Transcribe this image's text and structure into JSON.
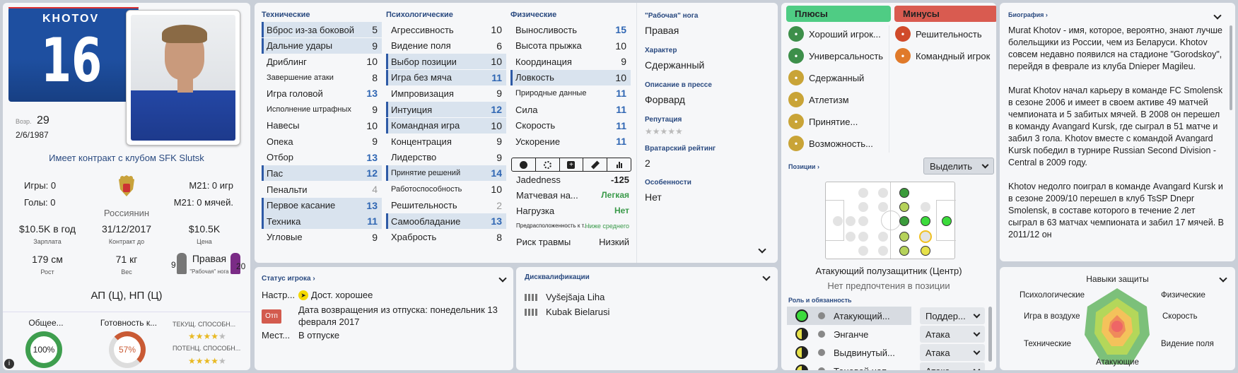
{
  "player": {
    "name": "KHOTOV",
    "number": "16",
    "age_label": "Возр.",
    "age": "29",
    "birthdate": "2/6/1987",
    "contract_club": "Имеет контракт с клубом SFK Slutsk",
    "games": "Игры: 0",
    "goals": "Голы: 0",
    "u21_games": "М21: 0 игр",
    "u21_goals": "М21: 0 мячей.",
    "nationality": "Россиянин",
    "wage": "$10.5K в год",
    "wage_label": "Зарплата",
    "contract_end": "31/12/2017",
    "contract_end_label": "Контракт до",
    "value": "$10.5K",
    "value_label": "Цена",
    "height": "179 см",
    "height_label": "Рост",
    "weight": "71 кг",
    "weight_label": "Вес",
    "foot": "Правая",
    "foot_label": "\"Рабочая\" нога",
    "left_foot_rating": "9",
    "right_foot_rating": "20",
    "positions": "АП (Ц), НП (Ц)",
    "overall_label": "Общее...",
    "overall": "100%",
    "readiness_label": "Готовность к...",
    "readiness": "57%",
    "current_ability_label": "ТЕКУЩ. СПОСОБН...",
    "potential_ability_label": "ПОТЕНЦ. СПОСОБН...",
    "current_ability_stars": 4,
    "potential_ability_stars": 4
  },
  "attributes": {
    "technical_title": "Технические",
    "mental_title": "Психологические",
    "physical_title": "Физические",
    "technical": [
      {
        "label": "Вброс из-за боковой",
        "value": "5",
        "hl": true,
        "style": ""
      },
      {
        "label": "Дальние удары",
        "value": "9",
        "hl": true,
        "style": ""
      },
      {
        "label": "Дриблинг",
        "value": "10",
        "hl": false,
        "style": ""
      },
      {
        "label": "Завершение атаки",
        "value": "8",
        "hl": false,
        "style": "",
        "small": true
      },
      {
        "label": "Игра головой",
        "value": "13",
        "hl": false,
        "style": "blue"
      },
      {
        "label": "Исполнение штрафных",
        "value": "9",
        "hl": false,
        "style": "",
        "small": true
      },
      {
        "label": "Навесы",
        "value": "10",
        "hl": false,
        "style": ""
      },
      {
        "label": "Опека",
        "value": "9",
        "hl": false,
        "style": ""
      },
      {
        "label": "Отбор",
        "value": "13",
        "hl": false,
        "style": "blue"
      },
      {
        "label": "Пас",
        "value": "12",
        "hl": true,
        "style": "blue"
      },
      {
        "label": "Пенальти",
        "value": "4",
        "hl": false,
        "style": "grey"
      },
      {
        "label": "Первое касание",
        "value": "13",
        "hl": true,
        "style": "blue"
      },
      {
        "label": "Техника",
        "value": "11",
        "hl": true,
        "style": "blue"
      },
      {
        "label": "Угловые",
        "value": "9",
        "hl": false,
        "style": ""
      }
    ],
    "mental": [
      {
        "label": "Агрессивность",
        "value": "10",
        "hl": false,
        "style": ""
      },
      {
        "label": "Видение поля",
        "value": "6",
        "hl": false,
        "style": ""
      },
      {
        "label": "Выбор позиции",
        "value": "10",
        "hl": true,
        "style": ""
      },
      {
        "label": "Игра без мяча",
        "value": "11",
        "hl": true,
        "style": "blue"
      },
      {
        "label": "Импровизация",
        "value": "9",
        "hl": false,
        "style": ""
      },
      {
        "label": "Интуиция",
        "value": "12",
        "hl": true,
        "style": "blue"
      },
      {
        "label": "Командная игра",
        "value": "10",
        "hl": true,
        "style": ""
      },
      {
        "label": "Концентрация",
        "value": "9",
        "hl": false,
        "style": ""
      },
      {
        "label": "Лидерство",
        "value": "9",
        "hl": false,
        "style": ""
      },
      {
        "label": "Принятие решений",
        "value": "14",
        "hl": true,
        "style": "blue",
        "small": true
      },
      {
        "label": "Работоспособность",
        "value": "10",
        "hl": false,
        "style": "",
        "small": true
      },
      {
        "label": "Решительность",
        "value": "2",
        "hl": false,
        "style": "grey"
      },
      {
        "label": "Самообладание",
        "value": "13",
        "hl": true,
        "style": "blue"
      },
      {
        "label": "Храбрость",
        "value": "8",
        "hl": false,
        "style": ""
      }
    ],
    "physical": [
      {
        "label": "Выносливость",
        "value": "15",
        "hl": false,
        "style": "blue"
      },
      {
        "label": "Высота прыжка",
        "value": "10",
        "hl": false,
        "style": ""
      },
      {
        "label": "Координация",
        "value": "9",
        "hl": false,
        "style": ""
      },
      {
        "label": "Ловкость",
        "value": "10",
        "hl": true,
        "style": ""
      },
      {
        "label": "Природные данные",
        "value": "11",
        "hl": false,
        "style": "blue",
        "small": true
      },
      {
        "label": "Сила",
        "value": "11",
        "hl": false,
        "style": "blue"
      },
      {
        "label": "Скорость",
        "value": "11",
        "hl": false,
        "style": "blue"
      },
      {
        "label": "Ускорение",
        "value": "11",
        "hl": false,
        "style": "blue"
      }
    ]
  },
  "condition": {
    "jadedness_label": "Jadedness",
    "jadedness": "-125",
    "match_load_label": "Матчевая на...",
    "match_load": "Легкая",
    "load_label": "Нагрузка",
    "load": "Нет",
    "injury_prone_label": "Предрасположенность к т...",
    "injury_prone": "Ниже среднего",
    "injury_risk_label": "Риск травмы",
    "injury_risk": "Низкий"
  },
  "side": {
    "foot_label": "\"Рабочая\" нога",
    "foot": "Правая",
    "character_label": "Характер",
    "character": "Сдержанный",
    "press_label": "Описание в прессе",
    "press": "Форвард",
    "reputation_label": "Репутация",
    "reputation_stars": 0,
    "gk_rating_label": "Вратарский рейтинг",
    "gk_rating": "2",
    "features_label": "Особенности",
    "features": "Нет"
  },
  "traits": {
    "pros_label": "Плюсы",
    "cons_label": "Минусы",
    "pros": [
      {
        "label": "Хороший игрок...",
        "icon": "star-icon",
        "color": "#3d8f4a"
      },
      {
        "label": "Универсальность",
        "icon": "leaf-icon",
        "color": "#3d8f4a"
      },
      {
        "label": "Сдержанный",
        "icon": "balloon-icon",
        "color": "#c9a437"
      },
      {
        "label": "Атлетизм",
        "icon": "pen-icon",
        "color": "#c9a437"
      },
      {
        "label": "Принятие...",
        "icon": "hand-icon",
        "color": "#c9a437"
      },
      {
        "label": "Возможность...",
        "icon": "ball-icon",
        "color": "#c9a437"
      }
    ],
    "cons": [
      {
        "label": "Решительность",
        "icon": "magnifier-icon",
        "color": "#d04a2a"
      },
      {
        "label": "Командный игрок",
        "icon": "people-icon",
        "color": "#e07a2a"
      }
    ]
  },
  "positions": {
    "title": "Позиции",
    "highlight_btn": "Выделить",
    "main_position": "Атакующий полузащитник (Центр)",
    "preference": "Нет предпочтения в позиции"
  },
  "roles": {
    "title": "Роль и обязанность",
    "items": [
      {
        "role": "Атакующий...",
        "duty": "Поддер...",
        "fill": "full"
      },
      {
        "role": "Энганче",
        "duty": "Атака",
        "fill": "half"
      },
      {
        "role": "Выдвинутый...",
        "duty": "Атака",
        "fill": "half"
      },
      {
        "role": "Теневой нап...",
        "duty": "Атака",
        "fill": "half"
      }
    ]
  },
  "bio": {
    "title": "Биография",
    "p1": "Murat Khotov - имя, которое, вероятно, знают лучше болельщики из России, чем из Беларуси. Khotov совсем недавно появился на стадионе \"Gorodskoy\", перейдя в феврале из клуба Dnieper Magileu.",
    "p2": "Murat Khotov начал карьеру в команде FC Smolensk в сезоне 2006 и имеет в своем активе 49 матчей чемпионата и 5 забитых мячей. В 2008 он перешел в команду Avangard Kursk, где сыграл в 51 матче и забил 3 гола. Khotov вместе с командой Avangard Kursk победил в турнире Russian Second Division - Central в 2009 году.",
    "p3": "Khotov недолго поиграл в команде Avangard Kursk и в сезоне 2009/10 перешел в клуб TsSP Dnepr Smolensk, в составе которого в течение 2 лет сыграл в 63 матчах чемпионата и забил 17 мячей. В 2011/12 он"
  },
  "defense": {
    "title": "Навыки защиты",
    "axes": [
      "Психологические",
      "Физические",
      "Скорость",
      "Видение поля",
      "Атакующие",
      "Технические",
      "Игра в воздухе"
    ],
    "center": "Навыки защиты"
  },
  "status": {
    "title": "Статус игрока",
    "mood_label": "Настр...",
    "mood": "Дост. хорошее",
    "badge": "Отп",
    "return_text": "Дата возвращения из отпуска: понедельник 13 февраля 2017",
    "location_label": "Мест...",
    "location": "В отпуске"
  },
  "bans": {
    "title": "Дисквалификации",
    "items": [
      "Vyšejšaja Liha",
      "Kubak Bielarusi"
    ]
  },
  "colors": {
    "accent": "#2a4a80",
    "blue_value": "#2f66b3",
    "green": "#2d9c4a",
    "red": "#c94a3a"
  }
}
